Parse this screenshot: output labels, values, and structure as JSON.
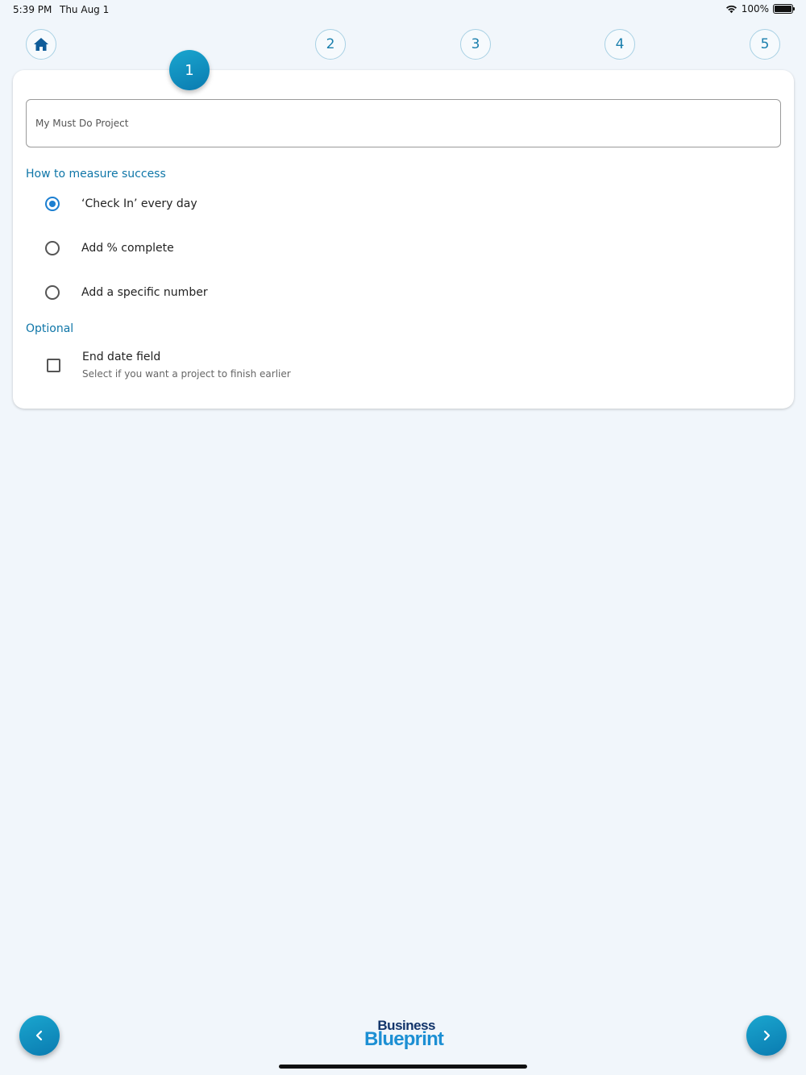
{
  "status_bar": {
    "time": "5:39 PM",
    "date": "Thu Aug 1",
    "battery": "100%"
  },
  "steps": {
    "items": [
      "2",
      "3",
      "4",
      "5"
    ],
    "active": "1"
  },
  "form": {
    "project_name_value": "My Must Do Project",
    "measure_title": "How to measure success",
    "options": [
      {
        "label": "‘Check In’ every day",
        "selected": true
      },
      {
        "label": "Add % complete",
        "selected": false
      },
      {
        "label": "Add a specific number",
        "selected": false
      }
    ],
    "optional_title": "Optional",
    "end_date": {
      "title": "End date field",
      "subtitle": "Select if you want a project to finish earlier",
      "checked": false
    }
  },
  "logo": {
    "line1": "Business",
    "line2": "Blueprint"
  },
  "colors": {
    "accent": "#0f76a8",
    "radio": "#1c7fd1",
    "background": "#f1f6fb"
  },
  "icons": {
    "home": "home-icon",
    "back": "chevron-left-icon",
    "next": "chevron-right-icon"
  }
}
